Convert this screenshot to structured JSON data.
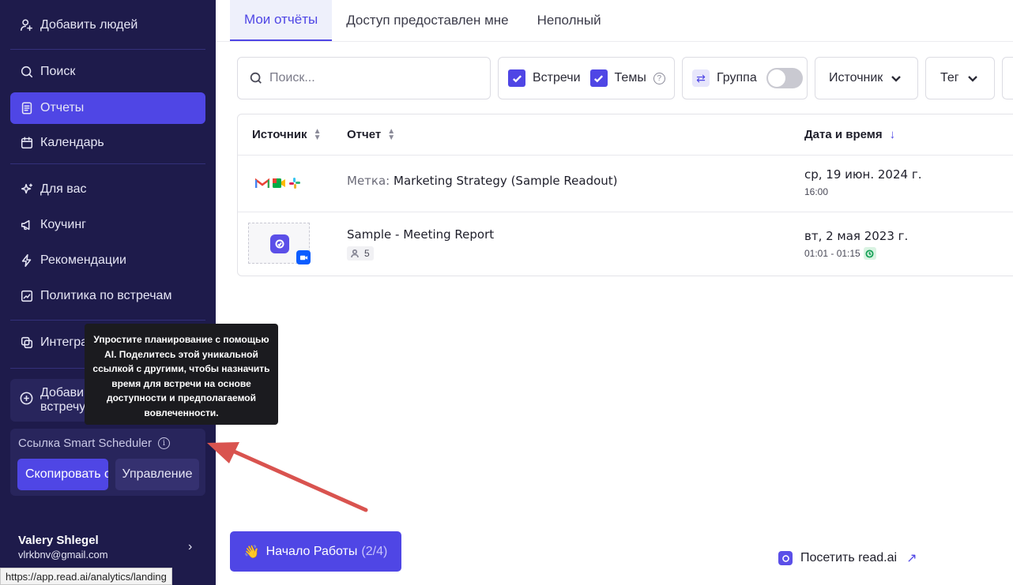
{
  "sidebar": {
    "items": [
      {
        "label": "Добавить людей",
        "icon": "add-user-icon"
      },
      {
        "label": "Поиск",
        "icon": "search-icon"
      },
      {
        "label": "Отчеты",
        "icon": "report-icon",
        "active": true
      },
      {
        "label": "Календарь",
        "icon": "calendar-icon"
      },
      {
        "label": "Для вас",
        "icon": "sparkle-icon"
      },
      {
        "label": "Коучинг",
        "icon": "megaphone-icon"
      },
      {
        "label": "Рекомендации",
        "icon": "bolt-icon"
      },
      {
        "label": "Политика по встречам",
        "icon": "policy-icon"
      },
      {
        "label": "Интегра",
        "icon": "integrations-icon"
      }
    ],
    "add_meeting_label_line1": "Добави",
    "add_meeting_label_line2": "встречу",
    "scheduler": {
      "title": "Ссылка Smart Scheduler",
      "copy_label": "Скопировать ссылку",
      "manage_label": "Управление"
    },
    "user": {
      "name": "Valery Shlegel",
      "email": "vlrkbnv@gmail.com"
    }
  },
  "status_url": "https://app.read.ai/analytics/landing",
  "tooltip": "Упростите планирование с помощью AI. Поделитесь этой уникальной ссылкой с другими, чтобы назначить время для встречи на основе доступности и предполагаемой вовлеченности.",
  "tabs": [
    {
      "label": "Мои отчёты",
      "active": true
    },
    {
      "label": "Доступ предоставлен мне"
    },
    {
      "label": "Неполный"
    }
  ],
  "filters": {
    "search_placeholder": "Поиск...",
    "meetings_label": "Встречи",
    "topics_label": "Темы",
    "group_label": "Группа",
    "source_label": "Источник",
    "tag_label": "Тег"
  },
  "table": {
    "headers": {
      "source": "Источник",
      "report": "Отчет",
      "datetime": "Дата и время"
    },
    "rows": [
      {
        "tag_prefix": "Метка:",
        "title": "Marketing Strategy (Sample Readout)",
        "date": "ср, 19 июн. 2024 г.",
        "time": "16:00"
      },
      {
        "title": "Sample - Meeting Report",
        "participants": "5",
        "date": "вт, 2 мая 2023 г.",
        "time": "01:01 - 01:15"
      }
    ]
  },
  "onboarding": {
    "label": "Начало Работы",
    "progress": "(2/4)"
  },
  "visit_label": "Посетить read.ai",
  "colors": {
    "sidebar_bg": "#1e1b4b",
    "accent": "#4f46e5",
    "annotation_arrow": "#d9534f"
  }
}
